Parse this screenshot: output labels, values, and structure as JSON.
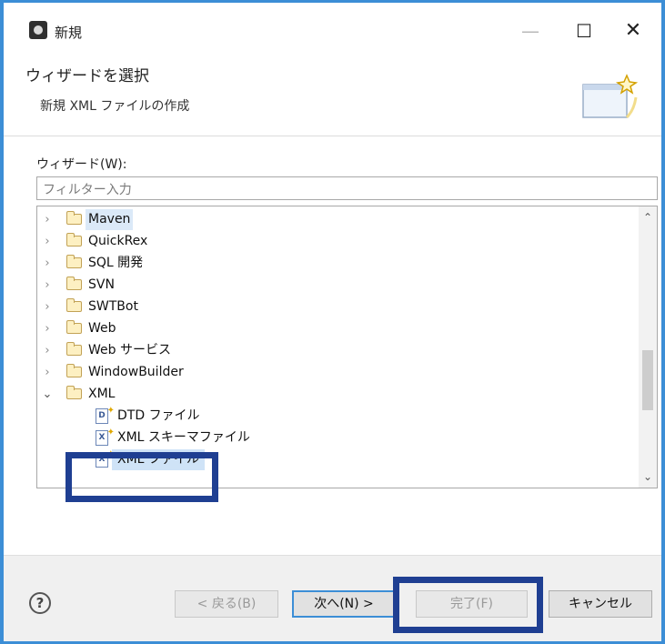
{
  "window": {
    "title": "新規",
    "min": "—",
    "max": "☐",
    "close": "✕"
  },
  "banner": {
    "title": "ウィザードを選択",
    "description": "新規 XML ファイルの作成"
  },
  "wizard": {
    "label": "ウィザード(W):",
    "filter_placeholder": "フィルター入力"
  },
  "tree": [
    {
      "label": "Maven",
      "type": "folder",
      "expanded": false
    },
    {
      "label": "QuickRex",
      "type": "folder",
      "expanded": false
    },
    {
      "label": "SQL 開発",
      "type": "folder",
      "expanded": false
    },
    {
      "label": "SVN",
      "type": "folder",
      "expanded": false
    },
    {
      "label": "SWTBot",
      "type": "folder",
      "expanded": false
    },
    {
      "label": "Web",
      "type": "folder",
      "expanded": false
    },
    {
      "label": "Web サービス",
      "type": "folder",
      "expanded": false
    },
    {
      "label": "WindowBuilder",
      "type": "folder",
      "expanded": false
    },
    {
      "label": "XML",
      "type": "folder",
      "expanded": true
    },
    {
      "label": "DTD ファイル",
      "type": "file",
      "icon": "D"
    },
    {
      "label": "XML スキーマファイル",
      "type": "file",
      "icon": "X"
    },
    {
      "label": "XML ファイル",
      "type": "file",
      "icon": "X",
      "selected": true
    }
  ],
  "buttons": {
    "help": "?",
    "back": "< 戻る(B)",
    "next": "次へ(N) >",
    "finish": "完了(F)",
    "cancel": "キャンセル"
  },
  "colors": {
    "accent": "#3c8ed6",
    "highlight_box": "#1f3f92",
    "selection": "#cfe3f7"
  }
}
